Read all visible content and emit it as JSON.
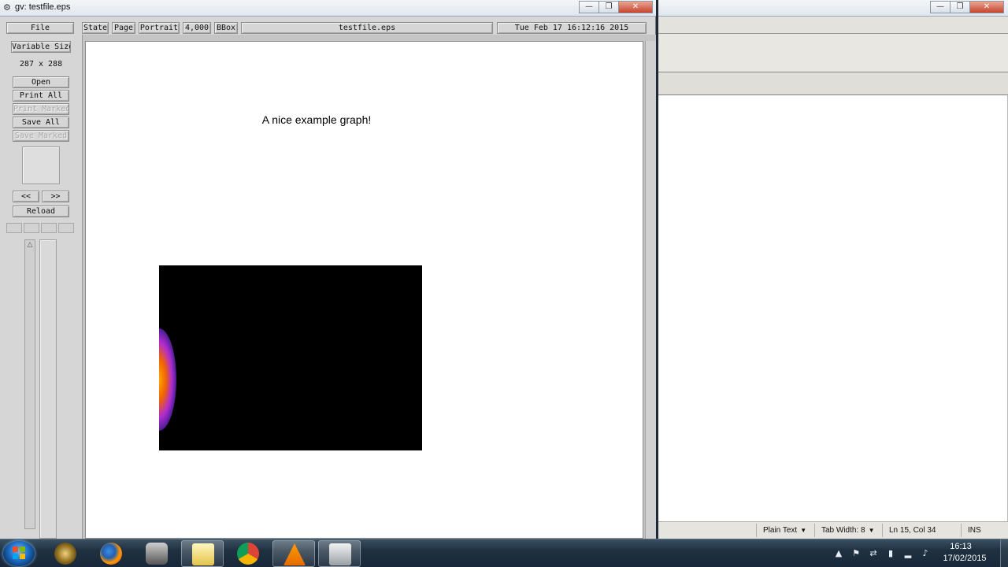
{
  "gv_window": {
    "title": "gv: testfile.eps",
    "window_controls": {
      "minimize": "—",
      "maximize": "❐",
      "close": "✕"
    }
  },
  "gv_toolbar": {
    "file_label": "File",
    "state_label": "State",
    "page_label": "Page",
    "orientation_label": "Portrait",
    "scale_label": "4,000",
    "bbox_label": "BBox",
    "filename": "testfile.eps",
    "date": "Tue Feb 17 16:12:16 2015"
  },
  "gv_side": {
    "size_mode": "Variable Size",
    "dimensions": "287 x 288",
    "open_label": "Open",
    "print_all_label": "Print All",
    "print_marked_label": "Print Marked",
    "save_all_label": "Save All",
    "save_marked_label": "Save Marked",
    "prev_label": "<<",
    "next_label": ">>",
    "reload_label": "Reload"
  },
  "document": {
    "graph_title": "A nice example graph!"
  },
  "editor_status": {
    "mode": "Plain Text",
    "tab_width": "Tab Width:  8",
    "cursor": "Ln 15, Col 34",
    "insert_mode": "INS"
  },
  "taskbar": {
    "items": [
      "start",
      "game-launcher",
      "firefox",
      "unknown-helmet-app",
      "file-explorer",
      "chrome",
      "vlc",
      "xming"
    ],
    "clock_time": "16:13",
    "clock_date": "17/02/2015"
  },
  "colors": {
    "gv_background": "#d6d6d6",
    "taskbar_background": "#1f3141",
    "graph_background": "#000000",
    "glow_core": "#ffa700",
    "glow_edge": "#b12cd0"
  }
}
